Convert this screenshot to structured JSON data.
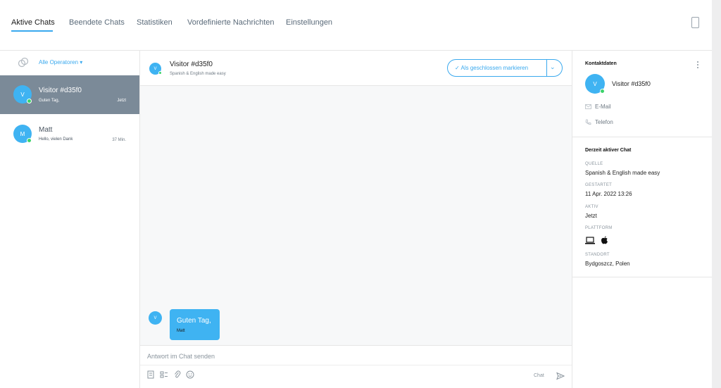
{
  "nav": {
    "tabs": [
      {
        "label": "Aktive Chats",
        "active": true
      },
      {
        "label": "Beendete Chats",
        "active": false
      },
      {
        "label": "Statistiken",
        "active": false
      },
      {
        "label": "Vordefinierte Nachrichten",
        "active": false
      },
      {
        "label": "Einstellungen",
        "active": false
      }
    ],
    "device_icon": "mobile-phone-icon"
  },
  "sidebar": {
    "operator_filter": "Alle Operatoren",
    "chats": [
      {
        "initial": "V",
        "name": "Visitor #d35f0",
        "preview": "Guten Tag,",
        "time": "Jetzt",
        "online": true,
        "selected": true
      },
      {
        "initial": "M",
        "name": "Matt",
        "preview": "Hello, vielen Dank",
        "time": "37 Min.",
        "online": true,
        "selected": false
      }
    ]
  },
  "conversation": {
    "avatar_initial": "V",
    "title": "Visitor #d35f0",
    "subtitle": "Spanish & English made easy",
    "close_button": "Als geschlossen markieren",
    "messages": [
      {
        "avatar_initial": "V",
        "text": "Guten Tag,",
        "author": "Matt"
      }
    ],
    "composer_placeholder": "Antwort im Chat senden",
    "composer_mode": "Chat"
  },
  "details": {
    "contact_title": "Kontaktdaten",
    "avatar_initial": "V",
    "visitor_name": "Visitor #d35f0",
    "email_label": "E-Mail",
    "phone_label": "Telefon",
    "active_chat_title": "Derzeit aktiver Chat",
    "fields": [
      {
        "label": "QUELLE",
        "value": "Spanish & English made easy"
      },
      {
        "label": "GESTARTET",
        "value": "11 Apr. 2022 13:26"
      },
      {
        "label": "AKTIV",
        "value": "Jetzt"
      },
      {
        "label": "PLATTFORM",
        "value": ""
      },
      {
        "label": "STANDORT",
        "value": "Bydgoszcz, Polen"
      }
    ],
    "platform_icons": [
      "laptop-icon",
      "apple-icon"
    ]
  },
  "colors": {
    "accent": "#3aa9ee",
    "avatar": "#3fb3f2",
    "online": "#3cd36a",
    "selected_row": "#7b8a98"
  }
}
